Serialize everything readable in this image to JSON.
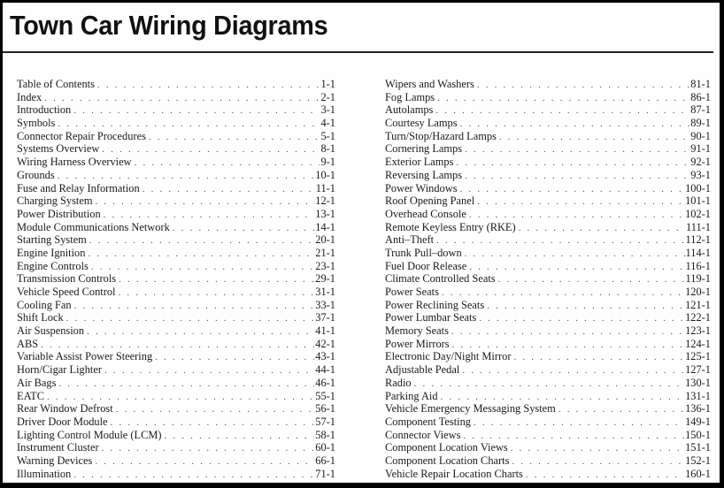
{
  "document": {
    "title": "Town Car Wiring Diagrams"
  },
  "toc": {
    "left_column": [
      {
        "label": "Table of Contents",
        "page": "1-1"
      },
      {
        "label": "Index",
        "page": "2-1"
      },
      {
        "label": "Introduction",
        "page": "3-1"
      },
      {
        "label": "Symbols",
        "page": "4-1"
      },
      {
        "label": "Connector Repair Procedures",
        "page": "5-1"
      },
      {
        "label": "Systems Overview",
        "page": "8-1"
      },
      {
        "label": "Wiring Harness Overview",
        "page": "9-1"
      },
      {
        "label": "Grounds",
        "page": "10-1"
      },
      {
        "label": "Fuse and Relay Information",
        "page": "11-1"
      },
      {
        "label": "Charging System",
        "page": "12-1"
      },
      {
        "label": "Power Distribution",
        "page": "13-1"
      },
      {
        "label": "Module Communications Network",
        "page": "14-1"
      },
      {
        "label": "Starting System",
        "page": "20-1"
      },
      {
        "label": "Engine Ignition",
        "page": "21-1"
      },
      {
        "label": "Engine Controls",
        "page": "23-1"
      },
      {
        "label": "Transmission Controls",
        "page": "29-1"
      },
      {
        "label": "Vehicle Speed Control",
        "page": "31-1"
      },
      {
        "label": "Cooling Fan",
        "page": "33-1"
      },
      {
        "label": "Shift Lock",
        "page": "37-1"
      },
      {
        "label": "Air Suspension",
        "page": "41-1"
      },
      {
        "label": "ABS",
        "page": "42-1"
      },
      {
        "label": "Variable Assist Power Steering",
        "page": "43-1"
      },
      {
        "label": "Horn/Cigar Lighter",
        "page": "44-1"
      },
      {
        "label": "Air Bags",
        "page": "46-1"
      },
      {
        "label": "EATC",
        "page": "55-1"
      },
      {
        "label": "Rear Window Defrost",
        "page": "56-1"
      },
      {
        "label": "Driver Door Module",
        "page": "57-1"
      },
      {
        "label": "Lighting Control Module (LCM)",
        "page": "58-1"
      },
      {
        "label": "Instrument Cluster",
        "page": "60-1"
      },
      {
        "label": "Warning Devices",
        "page": "66-1"
      },
      {
        "label": "Illumination",
        "page": "71-1"
      }
    ],
    "right_column": [
      {
        "label": "Wipers and Washers",
        "page": "81-1"
      },
      {
        "label": "Fog Lamps",
        "page": "86-1"
      },
      {
        "label": "Autolamps",
        "page": "87-1"
      },
      {
        "label": "Courtesy Lamps",
        "page": "89-1"
      },
      {
        "label": "Turn/Stop/Hazard Lamps",
        "page": "90-1"
      },
      {
        "label": "Cornering Lamps",
        "page": "91-1"
      },
      {
        "label": "Exterior Lamps",
        "page": "92-1"
      },
      {
        "label": "Reversing Lamps",
        "page": "93-1"
      },
      {
        "label": "Power Windows",
        "page": "100-1"
      },
      {
        "label": "Roof Opening Panel",
        "page": "101-1"
      },
      {
        "label": "Overhead Console",
        "page": "102-1"
      },
      {
        "label": "Remote Keyless Entry (RKE)",
        "page": "111-1"
      },
      {
        "label": "Anti–Theft",
        "page": "112-1"
      },
      {
        "label": "Trunk Pull–down",
        "page": "114-1"
      },
      {
        "label": "Fuel Door Release",
        "page": "116-1"
      },
      {
        "label": "Climate Controlled Seats",
        "page": "119-1"
      },
      {
        "label": "Power Seats",
        "page": "120-1"
      },
      {
        "label": "Power Reclining Seats",
        "page": "121-1"
      },
      {
        "label": "Power Lumbar Seats",
        "page": "122-1"
      },
      {
        "label": "Memory Seats",
        "page": "123-1"
      },
      {
        "label": "Power Mirrors",
        "page": "124-1"
      },
      {
        "label": "Electronic Day/Night Mirror",
        "page": "125-1"
      },
      {
        "label": "Adjustable Pedal",
        "page": "127-1"
      },
      {
        "label": "Radio",
        "page": "130-1"
      },
      {
        "label": "Parking Aid",
        "page": "131-1"
      },
      {
        "label": "Vehicle Emergency Messaging System",
        "page": "136-1"
      },
      {
        "label": "Component Testing",
        "page": "149-1"
      },
      {
        "label": "Connector Views",
        "page": "150-1"
      },
      {
        "label": "Component Location Views",
        "page": "151-1"
      },
      {
        "label": "Component Location Charts",
        "page": "152-1"
      },
      {
        "label": "Vehicle Repair Location Charts",
        "page": "160-1"
      }
    ]
  }
}
